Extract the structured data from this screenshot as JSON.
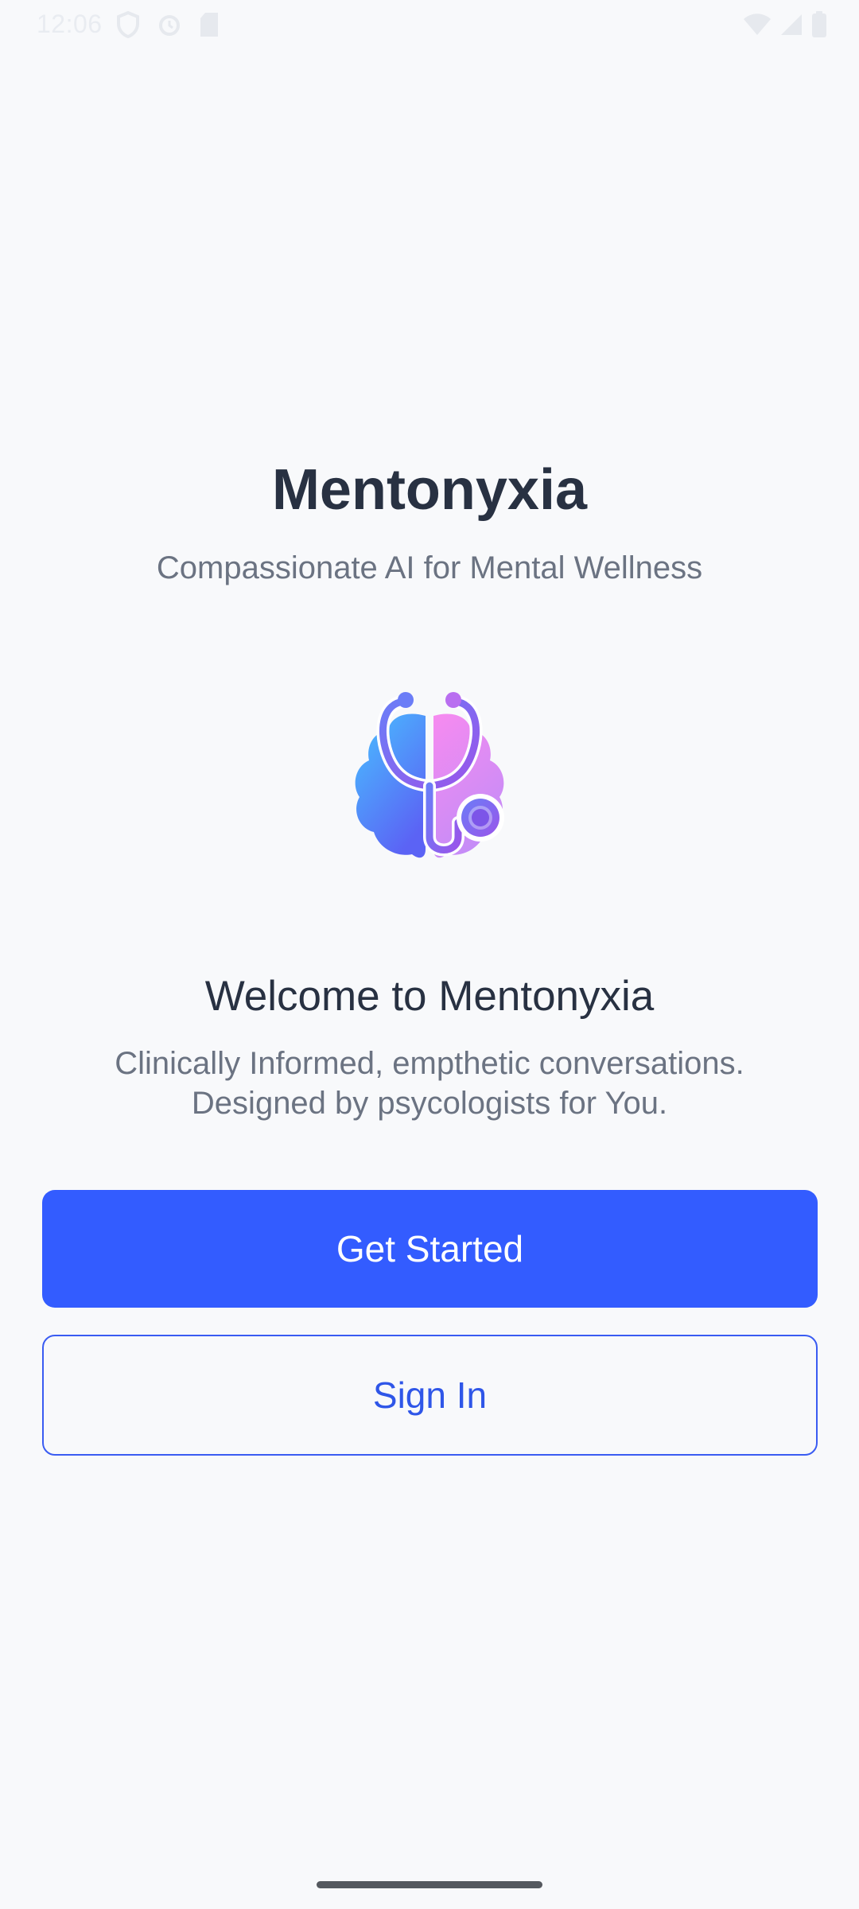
{
  "status_bar": {
    "time": "12:06",
    "left_icons": [
      "vpn-shield-icon",
      "alarm-icon",
      "sd-card-icon"
    ],
    "right_icons": [
      "wifi-icon",
      "signal-icon",
      "battery-icon"
    ]
  },
  "header": {
    "title": "Mentonyxia",
    "subtitle": "Compassionate AI for Mental Wellness"
  },
  "logo": {
    "icon": "brain-stethoscope-icon",
    "colors": {
      "brain_left": "#4aa6ff",
      "brain_right": "#f08cf5",
      "stethoscope": "#7a5cf0"
    }
  },
  "welcome": {
    "title": "Welcome to Mentonyxia",
    "description_line1": "Clinically Informed, empthetic conversations.",
    "description_line2": "Designed by psycologists for You."
  },
  "actions": {
    "primary_label": "Get Started",
    "secondary_label": "Sign In"
  },
  "colors": {
    "background": "#f8f9fb",
    "accent": "#335cff",
    "title_text": "#283142",
    "muted_text": "#6b7382"
  }
}
